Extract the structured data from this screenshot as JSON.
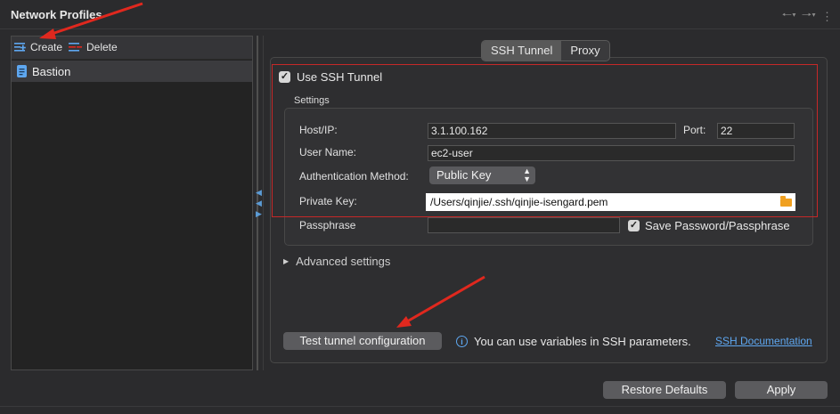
{
  "window": {
    "title": "Network Profiles"
  },
  "nav": {
    "back_icon": "back-arrow-icon",
    "forward_icon": "forward-arrow-icon",
    "menu_icon": "more-vertical-icon"
  },
  "sidebar": {
    "create_label": "Create",
    "delete_label": "Delete",
    "items": [
      {
        "label": "Bastion",
        "icon": "profile-icon"
      }
    ]
  },
  "tabs": [
    {
      "label": "SSH Tunnel",
      "active": true
    },
    {
      "label": "Proxy",
      "active": false
    }
  ],
  "ssh": {
    "use_ssh_label": "Use SSH Tunnel",
    "use_ssh_checked": true,
    "settings_label": "Settings",
    "host_label": "Host/IP:",
    "host_value": "3.1.100.162",
    "port_label": "Port:",
    "port_value": "22",
    "user_label": "User Name:",
    "user_value": "ec2-user",
    "auth_label": "Authentication Method:",
    "auth_value": "Public Key",
    "key_label": "Private Key:",
    "key_value": "/Users/qinjie/.ssh/qinjie-isengard.pem",
    "passphrase_label": "Passphrase",
    "passphrase_value": "",
    "save_pass_label": "Save Password/Passphrase",
    "save_pass_checked": true,
    "advanced_label": "Advanced settings"
  },
  "footer": {
    "test_button": "Test tunnel configuration",
    "info_text": "You can use variables in SSH parameters.",
    "doc_link": "SSH Documentation",
    "restore_button": "Restore Defaults",
    "apply_button": "Apply"
  },
  "colors": {
    "accent_blue": "#5ea7f0",
    "highlight_red": "#c62828",
    "arrow_red": "#e0281e",
    "folder_orange": "#f0a020"
  }
}
